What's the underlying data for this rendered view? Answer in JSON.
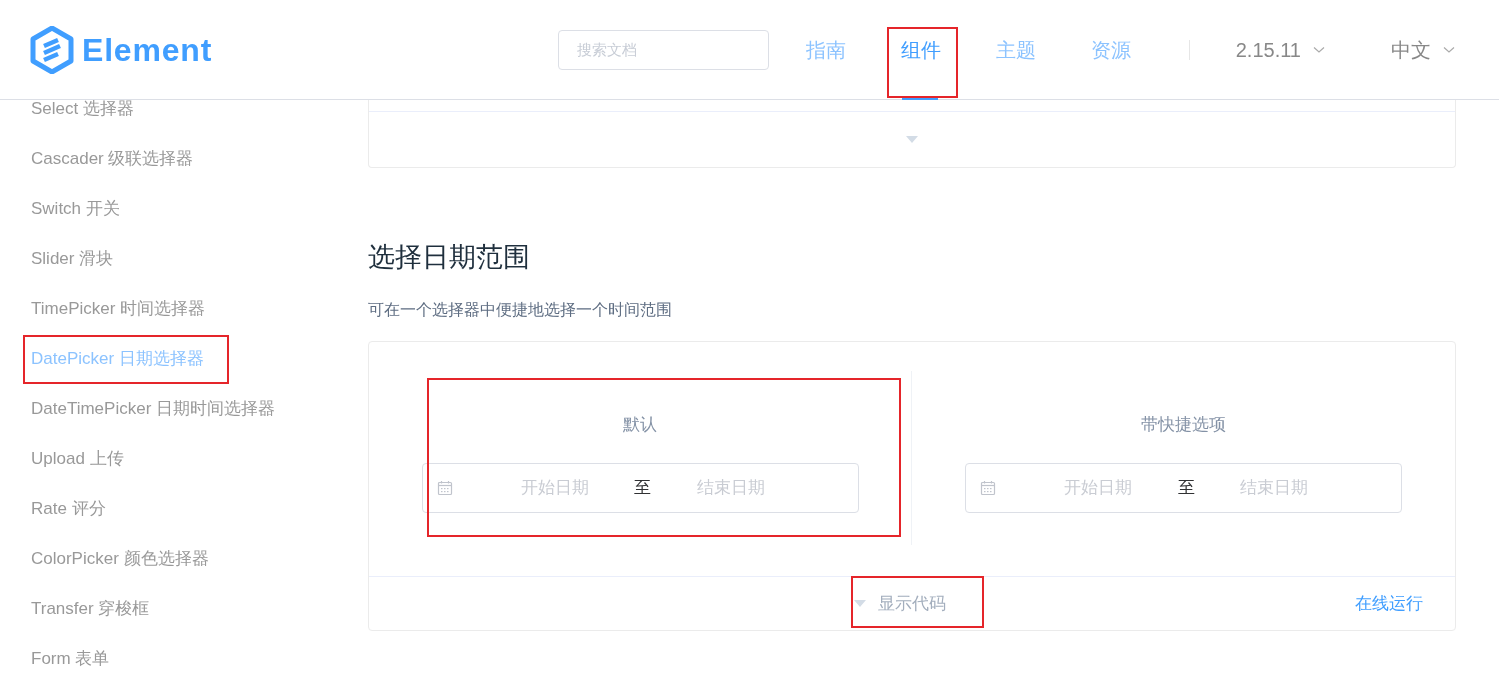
{
  "header": {
    "logo": "Element",
    "search": {
      "placeholder": "搜索文档"
    },
    "nav": [
      {
        "label": "指南",
        "selected": false,
        "highlighted": false
      },
      {
        "label": "组件",
        "selected": true,
        "highlighted": true
      },
      {
        "label": "主题",
        "selected": false,
        "highlighted": false
      },
      {
        "label": "资源",
        "selected": false,
        "highlighted": false
      }
    ],
    "version": "2.15.11",
    "language": "中文"
  },
  "sidebar": {
    "items": [
      {
        "label": "Select 选择器",
        "selected": false,
        "highlighted": false
      },
      {
        "label": "Cascader 级联选择器",
        "selected": false,
        "highlighted": false
      },
      {
        "label": "Switch 开关",
        "selected": false,
        "highlighted": false
      },
      {
        "label": "Slider 滑块",
        "selected": false,
        "highlighted": false
      },
      {
        "label": "TimePicker 时间选择器",
        "selected": false,
        "highlighted": false
      },
      {
        "label": "DatePicker 日期选择器",
        "selected": true,
        "highlighted": true
      },
      {
        "label": "DateTimePicker 日期时间选择器",
        "selected": false,
        "highlighted": false
      },
      {
        "label": "Upload 上传",
        "selected": false,
        "highlighted": false
      },
      {
        "label": "Rate 评分",
        "selected": false,
        "highlighted": false
      },
      {
        "label": "ColorPicker 颜色选择器",
        "selected": false,
        "highlighted": false
      },
      {
        "label": "Transfer 穿梭框",
        "selected": false,
        "highlighted": false
      },
      {
        "label": "Form 表单",
        "selected": false,
        "highlighted": false
      }
    ]
  },
  "section": {
    "title": "选择日期范围",
    "description": "可在一个选择器中便捷地选择一个时间范围",
    "demos": [
      {
        "label": "默认",
        "start_placeholder": "开始日期",
        "separator": "至",
        "end_placeholder": "结束日期",
        "highlighted": true
      },
      {
        "label": "带快捷选项",
        "start_placeholder": "开始日期",
        "separator": "至",
        "end_placeholder": "结束日期",
        "highlighted": false
      }
    ],
    "show_code": {
      "label": "显示代码",
      "highlighted": true
    },
    "run_online": "在线运行"
  }
}
